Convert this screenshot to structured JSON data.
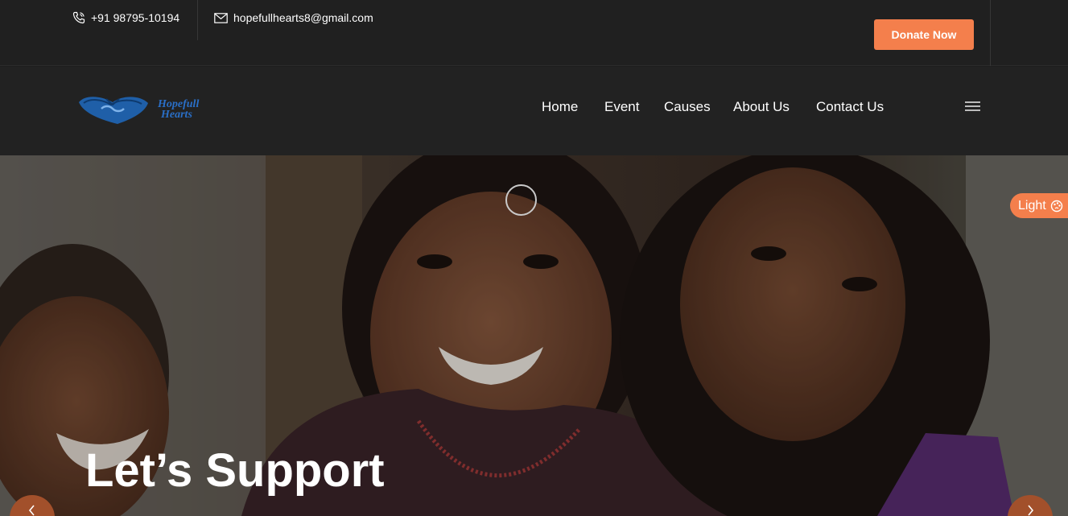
{
  "topbar": {
    "phone": "+91 98795-10194",
    "email": "hopefullhearts8@gmail.com",
    "donate_label": "Donate Now"
  },
  "brand": {
    "name_line1": "Hopefull",
    "name_line2": "Hearts"
  },
  "nav": {
    "items": [
      "Home",
      "Event",
      "Causes",
      "About Us",
      "Contact Us"
    ]
  },
  "hero": {
    "title": "Let’s Support",
    "theme_toggle_label": "Light"
  },
  "colors": {
    "accent": "#f47f4c",
    "background": "#202020",
    "logo_blue": "#2a6fc7"
  },
  "icons": {
    "phone": "phone-icon",
    "email": "envelope-icon",
    "menu": "hamburger-menu-icon",
    "theme": "palette-icon",
    "prev": "chevron-left-icon",
    "next": "chevron-right-icon"
  }
}
